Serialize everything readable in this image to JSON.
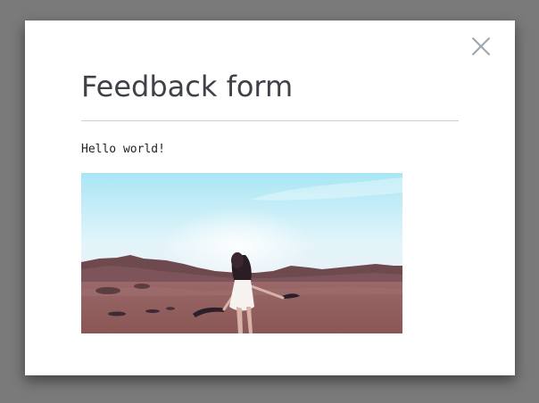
{
  "modal": {
    "title": "Feedback form",
    "message": "Hello world!",
    "close_icon": "close-icon",
    "image_subject": "woman in white dress in desert"
  },
  "colors": {
    "overlay": "#7a7a7a",
    "modal_background": "#ffffff",
    "title_text": "#3f4148",
    "close_icon": "#9aa7b0",
    "divider": "#cfcfcf"
  }
}
